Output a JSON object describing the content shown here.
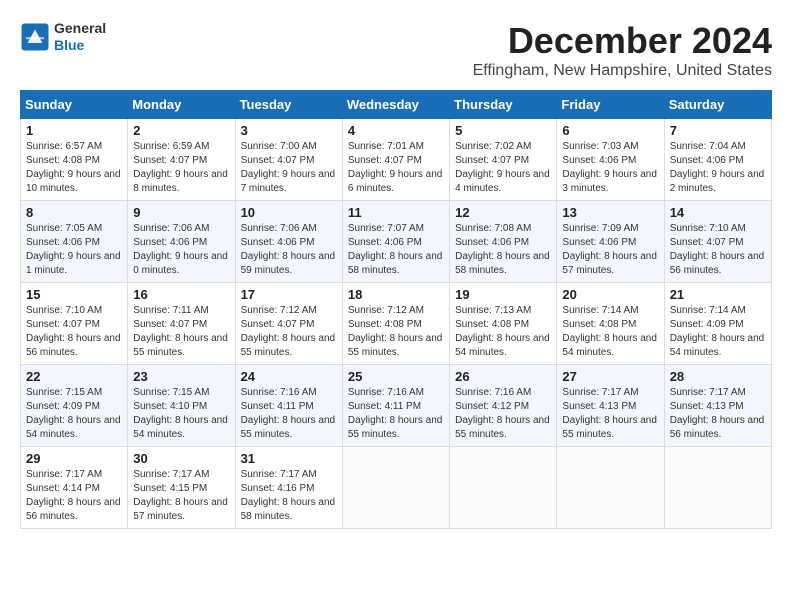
{
  "header": {
    "logo_general": "General",
    "logo_blue": "Blue",
    "title": "December 2024",
    "subtitle": "Effingham, New Hampshire, United States"
  },
  "calendar": {
    "days_of_week": [
      "Sunday",
      "Monday",
      "Tuesday",
      "Wednesday",
      "Thursday",
      "Friday",
      "Saturday"
    ],
    "weeks": [
      [
        {
          "day": "1",
          "sunrise": "6:57 AM",
          "sunset": "4:08 PM",
          "daylight": "9 hours and 10 minutes."
        },
        {
          "day": "2",
          "sunrise": "6:59 AM",
          "sunset": "4:07 PM",
          "daylight": "9 hours and 8 minutes."
        },
        {
          "day": "3",
          "sunrise": "7:00 AM",
          "sunset": "4:07 PM",
          "daylight": "9 hours and 7 minutes."
        },
        {
          "day": "4",
          "sunrise": "7:01 AM",
          "sunset": "4:07 PM",
          "daylight": "9 hours and 6 minutes."
        },
        {
          "day": "5",
          "sunrise": "7:02 AM",
          "sunset": "4:07 PM",
          "daylight": "9 hours and 4 minutes."
        },
        {
          "day": "6",
          "sunrise": "7:03 AM",
          "sunset": "4:06 PM",
          "daylight": "9 hours and 3 minutes."
        },
        {
          "day": "7",
          "sunrise": "7:04 AM",
          "sunset": "4:06 PM",
          "daylight": "9 hours and 2 minutes."
        }
      ],
      [
        {
          "day": "8",
          "sunrise": "7:05 AM",
          "sunset": "4:06 PM",
          "daylight": "9 hours and 1 minute."
        },
        {
          "day": "9",
          "sunrise": "7:06 AM",
          "sunset": "4:06 PM",
          "daylight": "9 hours and 0 minutes."
        },
        {
          "day": "10",
          "sunrise": "7:06 AM",
          "sunset": "4:06 PM",
          "daylight": "8 hours and 59 minutes."
        },
        {
          "day": "11",
          "sunrise": "7:07 AM",
          "sunset": "4:06 PM",
          "daylight": "8 hours and 58 minutes."
        },
        {
          "day": "12",
          "sunrise": "7:08 AM",
          "sunset": "4:06 PM",
          "daylight": "8 hours and 58 minutes."
        },
        {
          "day": "13",
          "sunrise": "7:09 AM",
          "sunset": "4:06 PM",
          "daylight": "8 hours and 57 minutes."
        },
        {
          "day": "14",
          "sunrise": "7:10 AM",
          "sunset": "4:07 PM",
          "daylight": "8 hours and 56 minutes."
        }
      ],
      [
        {
          "day": "15",
          "sunrise": "7:10 AM",
          "sunset": "4:07 PM",
          "daylight": "8 hours and 56 minutes."
        },
        {
          "day": "16",
          "sunrise": "7:11 AM",
          "sunset": "4:07 PM",
          "daylight": "8 hours and 55 minutes."
        },
        {
          "day": "17",
          "sunrise": "7:12 AM",
          "sunset": "4:07 PM",
          "daylight": "8 hours and 55 minutes."
        },
        {
          "day": "18",
          "sunrise": "7:12 AM",
          "sunset": "4:08 PM",
          "daylight": "8 hours and 55 minutes."
        },
        {
          "day": "19",
          "sunrise": "7:13 AM",
          "sunset": "4:08 PM",
          "daylight": "8 hours and 54 minutes."
        },
        {
          "day": "20",
          "sunrise": "7:14 AM",
          "sunset": "4:08 PM",
          "daylight": "8 hours and 54 minutes."
        },
        {
          "day": "21",
          "sunrise": "7:14 AM",
          "sunset": "4:09 PM",
          "daylight": "8 hours and 54 minutes."
        }
      ],
      [
        {
          "day": "22",
          "sunrise": "7:15 AM",
          "sunset": "4:09 PM",
          "daylight": "8 hours and 54 minutes."
        },
        {
          "day": "23",
          "sunrise": "7:15 AM",
          "sunset": "4:10 PM",
          "daylight": "8 hours and 54 minutes."
        },
        {
          "day": "24",
          "sunrise": "7:16 AM",
          "sunset": "4:11 PM",
          "daylight": "8 hours and 55 minutes."
        },
        {
          "day": "25",
          "sunrise": "7:16 AM",
          "sunset": "4:11 PM",
          "daylight": "8 hours and 55 minutes."
        },
        {
          "day": "26",
          "sunrise": "7:16 AM",
          "sunset": "4:12 PM",
          "daylight": "8 hours and 55 minutes."
        },
        {
          "day": "27",
          "sunrise": "7:17 AM",
          "sunset": "4:13 PM",
          "daylight": "8 hours and 55 minutes."
        },
        {
          "day": "28",
          "sunrise": "7:17 AM",
          "sunset": "4:13 PM",
          "daylight": "8 hours and 56 minutes."
        }
      ],
      [
        {
          "day": "29",
          "sunrise": "7:17 AM",
          "sunset": "4:14 PM",
          "daylight": "8 hours and 56 minutes."
        },
        {
          "day": "30",
          "sunrise": "7:17 AM",
          "sunset": "4:15 PM",
          "daylight": "8 hours and 57 minutes."
        },
        {
          "day": "31",
          "sunrise": "7:17 AM",
          "sunset": "4:16 PM",
          "daylight": "8 hours and 58 minutes."
        },
        null,
        null,
        null,
        null
      ]
    ],
    "labels": {
      "sunrise": "Sunrise:",
      "sunset": "Sunset:",
      "daylight": "Daylight:"
    }
  }
}
